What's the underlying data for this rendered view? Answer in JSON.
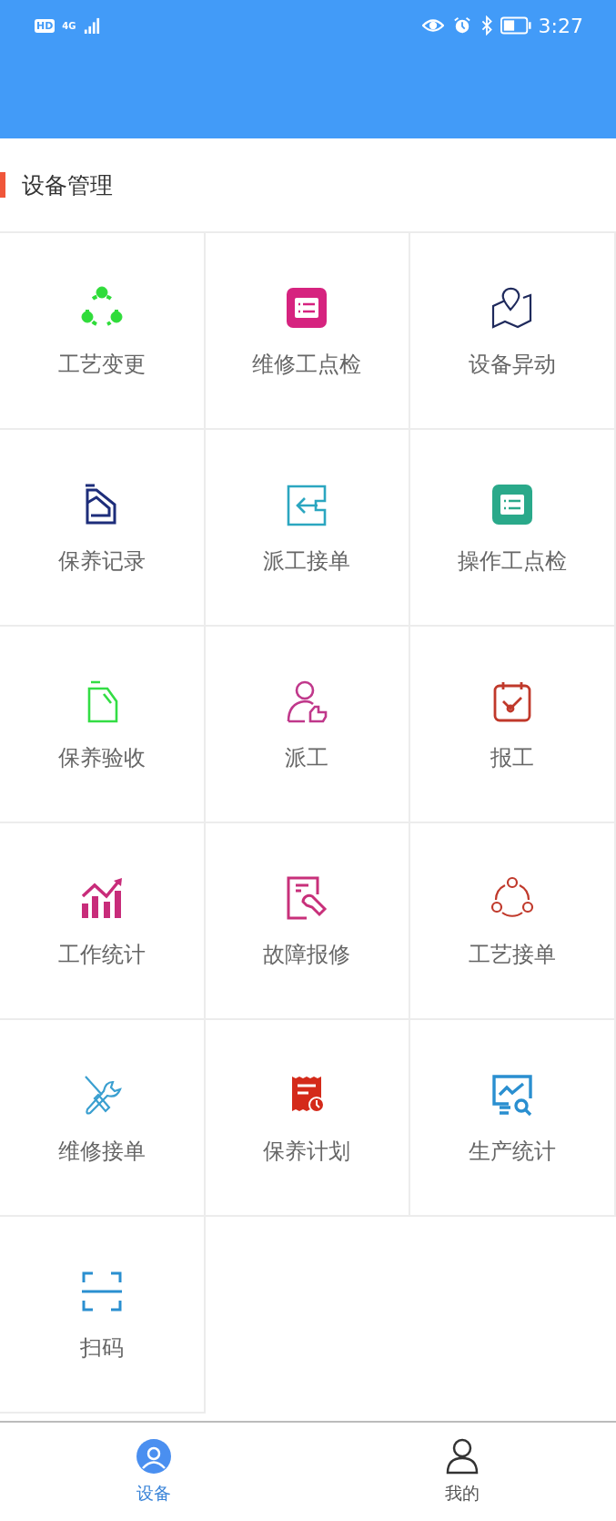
{
  "status_bar": {
    "hd": "HD",
    "network": "4G",
    "time": "3:27"
  },
  "section": {
    "title": "设备管理"
  },
  "items": [
    {
      "label": "工艺变更",
      "kind": "ring",
      "color": "#2fdc3a"
    },
    {
      "label": "维修工点检",
      "kind": "list-card",
      "color": "#d6237f"
    },
    {
      "label": "设备异动",
      "kind": "map",
      "color": "#1f2a5c"
    },
    {
      "label": "保养记录",
      "kind": "jerrycan",
      "color": "#1d2d7a"
    },
    {
      "label": "派工接单",
      "kind": "import",
      "color": "#2ba6c0"
    },
    {
      "label": "操作工点检",
      "kind": "list-card",
      "color": "#2aa98a"
    },
    {
      "label": "保养验收",
      "kind": "bottle",
      "color": "#33dd44"
    },
    {
      "label": "派工",
      "kind": "user-pointer",
      "color": "#c0388b"
    },
    {
      "label": "报工",
      "kind": "calendar",
      "color": "#c0392b"
    },
    {
      "label": "工作统计",
      "kind": "chart",
      "color": "#c82c7a"
    },
    {
      "label": "故障报修",
      "kind": "doc-wrench",
      "color": "#c8307a"
    },
    {
      "label": "工艺接单",
      "kind": "nodes",
      "color": "#c0392b"
    },
    {
      "label": "维修接单",
      "kind": "tools",
      "color": "#3a9fd0"
    },
    {
      "label": "保养计划",
      "kind": "receipt",
      "color": "#d42a1a"
    },
    {
      "label": "生产统计",
      "kind": "monitor-search",
      "color": "#2a8fd0"
    },
    {
      "label": "扫码",
      "kind": "scan",
      "color": "#2a8fd0"
    }
  ],
  "tabs": [
    {
      "label": "设备",
      "selected": true
    },
    {
      "label": "我的",
      "selected": false
    }
  ]
}
